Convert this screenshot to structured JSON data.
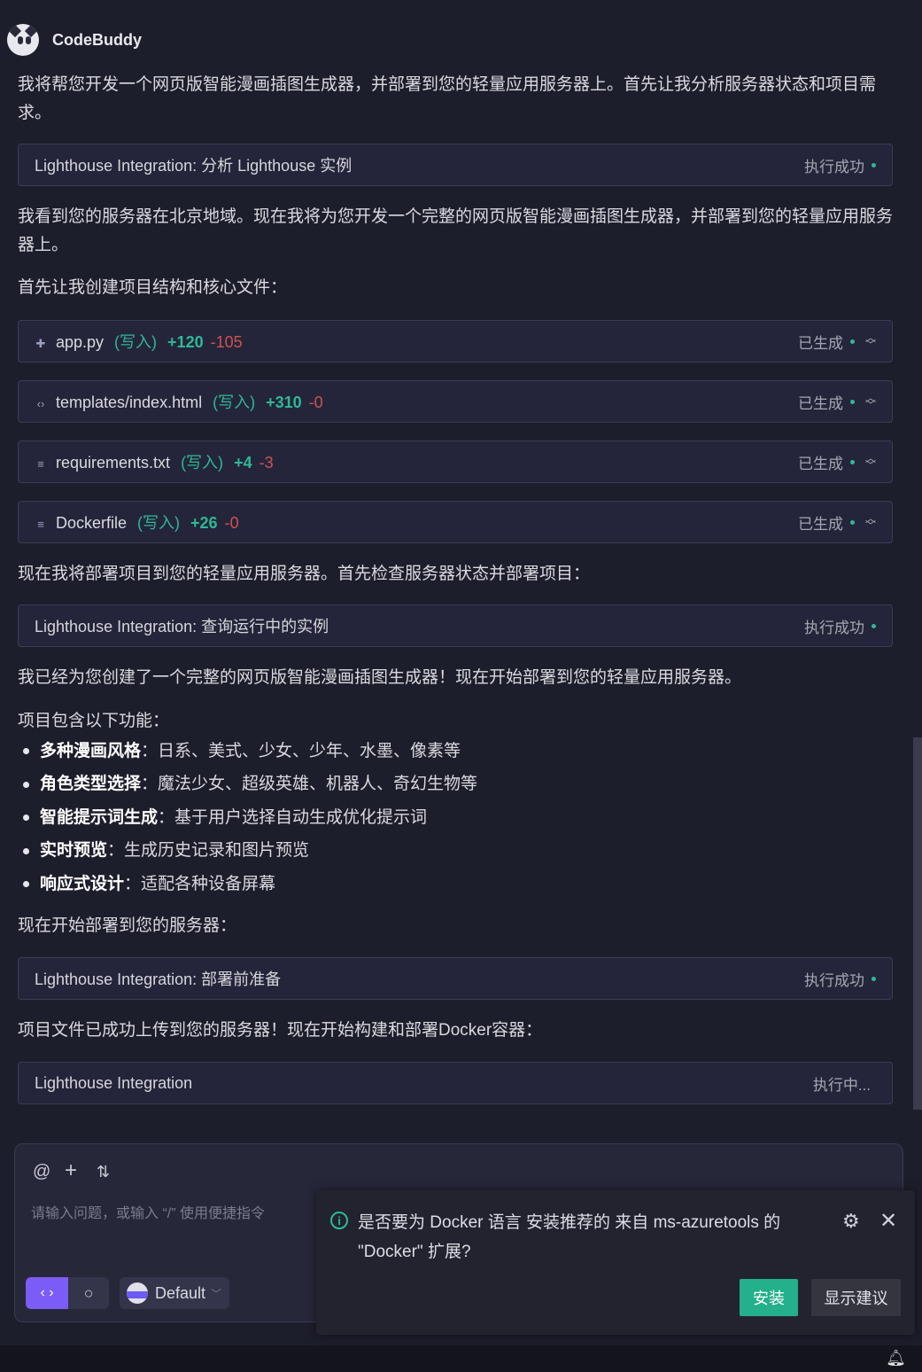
{
  "header": {
    "brand": "CodeBuddy"
  },
  "messages": {
    "m1": "我将帮您开发一个网页版智能漫画插图生成器，并部署到您的轻量应用服务器上。首先让我分析服务器状态和项目需求。",
    "m2": "我看到您的服务器在北京地域。现在我将为您开发一个完整的网页版智能漫画插图生成器，并部署到您的轻量应用服务器上。",
    "m3": "首先让我创建项目结构和核心文件：",
    "m4": "现在我将部署项目到您的轻量应用服务器。首先检查服务器状态并部署项目：",
    "m5": "我已经为您创建了一个完整的网页版智能漫画插图生成器！现在开始部署到您的轻量应用服务器。",
    "m6": "项目包含以下功能：",
    "m7": "现在开始部署到您的服务器：",
    "m8": "项目文件已成功上传到您的服务器！现在开始构建和部署Docker容器："
  },
  "tools": [
    {
      "title": "Lighthouse Integration: 分析 Lighthouse 实例",
      "status": "执行成功"
    },
    {
      "title": "Lighthouse Integration: 查询运行中的实例",
      "status": "执行成功"
    },
    {
      "title": "Lighthouse Integration: 部署前准备",
      "status": "执行成功"
    },
    {
      "title": "Lighthouse Integration",
      "status": "执行中..."
    }
  ],
  "files": [
    {
      "icon": "python-icon",
      "name": "app.py",
      "action": "(写入)",
      "added": "+120",
      "removed": "-105",
      "status": "已生成"
    },
    {
      "icon": "code-icon",
      "name": "templates/index.html",
      "action": "(写入)",
      "added": "+310",
      "removed": "-0",
      "status": "已生成"
    },
    {
      "icon": "text-file-icon",
      "name": "requirements.txt",
      "action": "(写入)",
      "added": "+4",
      "removed": "-3",
      "status": "已生成"
    },
    {
      "icon": "text-file-icon",
      "name": "Dockerfile",
      "action": "(写入)",
      "added": "+26",
      "removed": "-0",
      "status": "已生成"
    }
  ],
  "features": [
    {
      "label": "多种漫画风格",
      "desc": "：日系、美式、少女、少年、水墨、像素等"
    },
    {
      "label": "角色类型选择",
      "desc": "：魔法少女、超级英雄、机器人、奇幻生物等"
    },
    {
      "label": "智能提示词生成",
      "desc": "：基于用户选择自动生成优化提示词"
    },
    {
      "label": "实时预览",
      "desc": "：生成历史记录和图片预览"
    },
    {
      "label": "响应式设计",
      "desc": "：适配各种设备屏幕"
    }
  ],
  "input": {
    "placeholder": "请输入问题，或输入 “/” 使用便捷指令",
    "model": "Default"
  },
  "notification": {
    "message": "是否要为 Docker 语言 安装推荐的 来自 ms-azuretools 的 \"Docker\" 扩展?",
    "install": "安装",
    "show_suggestions": "显示建议"
  },
  "colors": {
    "accent": "#7c5cf6",
    "success": "#2fb896",
    "added": "#2fb896",
    "removed": "#d0524f"
  }
}
